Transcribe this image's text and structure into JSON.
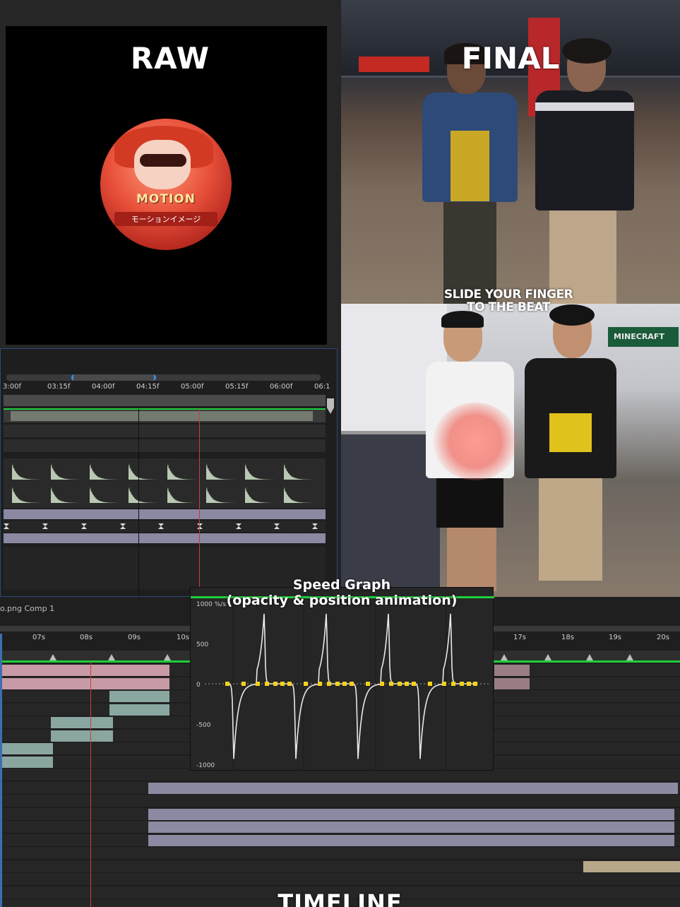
{
  "captions": {
    "raw": "RAW",
    "final": "FINAL",
    "slide_line1": "SLIDE YOUR FINGER",
    "slide_line2": "TO THE BEAT",
    "graph_title_line1": "Speed Graph",
    "graph_title_line2": "(opacity & position animation)",
    "timeline": "TIMELINE"
  },
  "logo": {
    "line1": "MOTION",
    "line2": "モーションイメージ"
  },
  "final_photo2": {
    "sign": "MINECRAFT"
  },
  "top_timeline": {
    "ticks": [
      "3:00f",
      "03:15f",
      "04:00f",
      "04:15f",
      "05:00f",
      "05:15f",
      "06:00f",
      "06:1"
    ]
  },
  "bottom_timeline": {
    "comp_name": "o.png Comp 1",
    "ticks": [
      "07s",
      "08s",
      "09s",
      "10s",
      "17s",
      "18s",
      "19s",
      "20s"
    ]
  },
  "speed_graph": {
    "y_label_top": "1000 %/s",
    "y_ticks": [
      "500",
      "0",
      "-500",
      "-1000"
    ]
  },
  "chart_data": {
    "type": "line",
    "title": "Speed Graph",
    "subtitle": "(opacity & position animation)",
    "ylabel": "",
    "ylim": [
      -1000,
      1000
    ],
    "y_ticks": [
      1000,
      500,
      0,
      -500,
      -1000
    ],
    "series": [
      {
        "values_description_x": [
          0,
          0.4,
          0.9,
          1.0,
          1.1,
          1.6,
          2.0,
          2.4,
          2.9,
          3.0,
          3.1,
          3.6,
          4.0,
          4.4,
          4.9,
          5.0,
          5.1,
          5.6,
          6.0,
          6.4,
          6.9,
          7.0,
          7.1,
          7.6,
          8.0
        ],
        "x": [
          0,
          0.4,
          0.9,
          1.0,
          1.1,
          1.6,
          2.0,
          2.4,
          2.9,
          3.0,
          3.1,
          3.6,
          4.0,
          4.4,
          4.9,
          5.0,
          5.1,
          5.6,
          6.0,
          6.4,
          6.9,
          7.0,
          7.1,
          7.6,
          8.0
        ],
        "y": [
          0,
          -1000,
          -200,
          950,
          200,
          0,
          0,
          -1000,
          -200,
          950,
          200,
          0,
          0,
          -1000,
          -200,
          950,
          200,
          0,
          0,
          -1000,
          -200,
          950,
          200,
          0,
          0
        ]
      }
    ]
  }
}
